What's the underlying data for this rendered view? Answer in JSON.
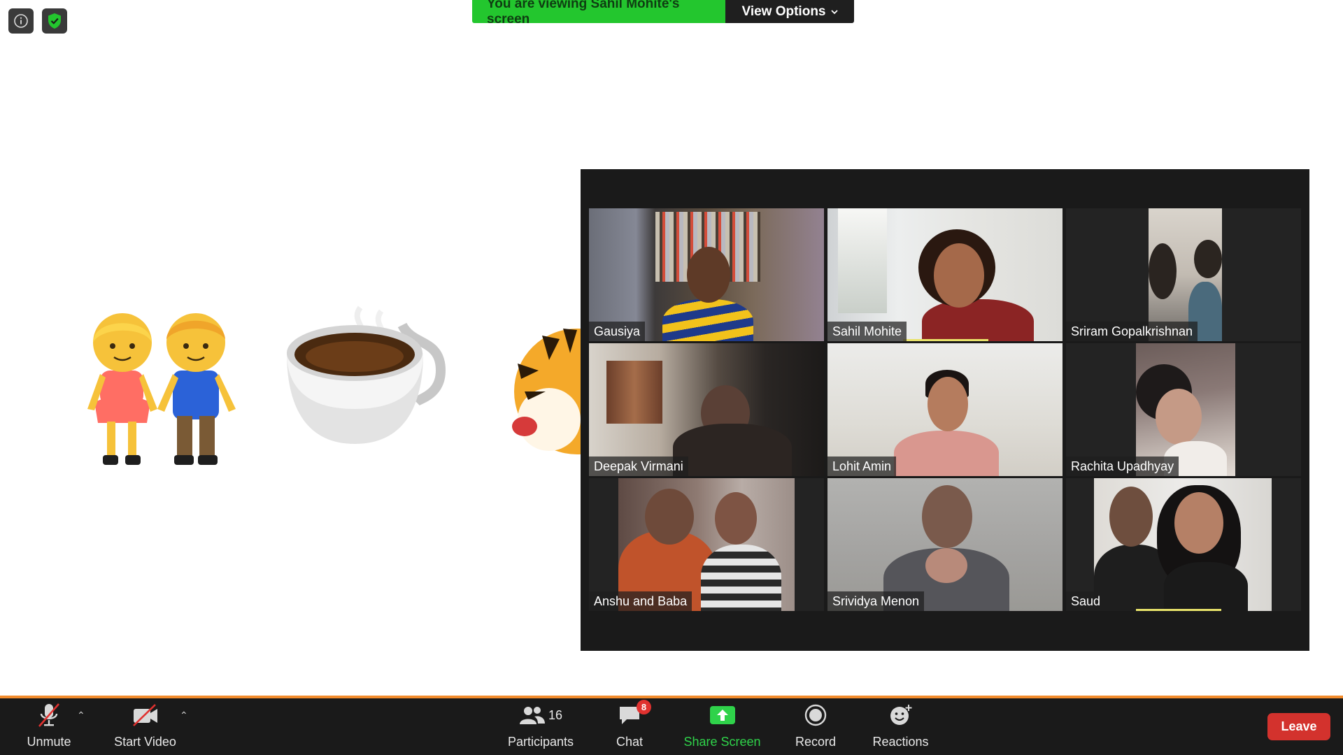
{
  "banner": {
    "viewing_text": "You are viewing Sahil Mohite's screen",
    "view_options_label": "View Options"
  },
  "icons": {
    "info": "info-icon",
    "security": "shield-check-icon"
  },
  "participants_tiles": [
    {
      "name": "Gausiya"
    },
    {
      "name": "Sahil Mohite"
    },
    {
      "name": "Sriram Gopalkrishnan"
    },
    {
      "name": "Deepak Virmani"
    },
    {
      "name": "Lohit Amin"
    },
    {
      "name": "Rachita Upadhyay"
    },
    {
      "name": "Anshu and Baba"
    },
    {
      "name": "Srividya Menon"
    },
    {
      "name": "Saud"
    }
  ],
  "toolbar": {
    "unmute_label": "Unmute",
    "start_video_label": "Start Video",
    "participants_label": "Participants",
    "participants_count": "16",
    "chat_label": "Chat",
    "chat_badge": "8",
    "share_screen_label": "Share Screen",
    "record_label": "Record",
    "reactions_label": "Reactions",
    "leave_label": "Leave"
  },
  "colors": {
    "banner_green": "#23c62e",
    "share_green": "#2fd24a",
    "leave_red": "#d3322d",
    "active_speaker": "#e9e36b",
    "accent_orange": "#f28b2c"
  }
}
